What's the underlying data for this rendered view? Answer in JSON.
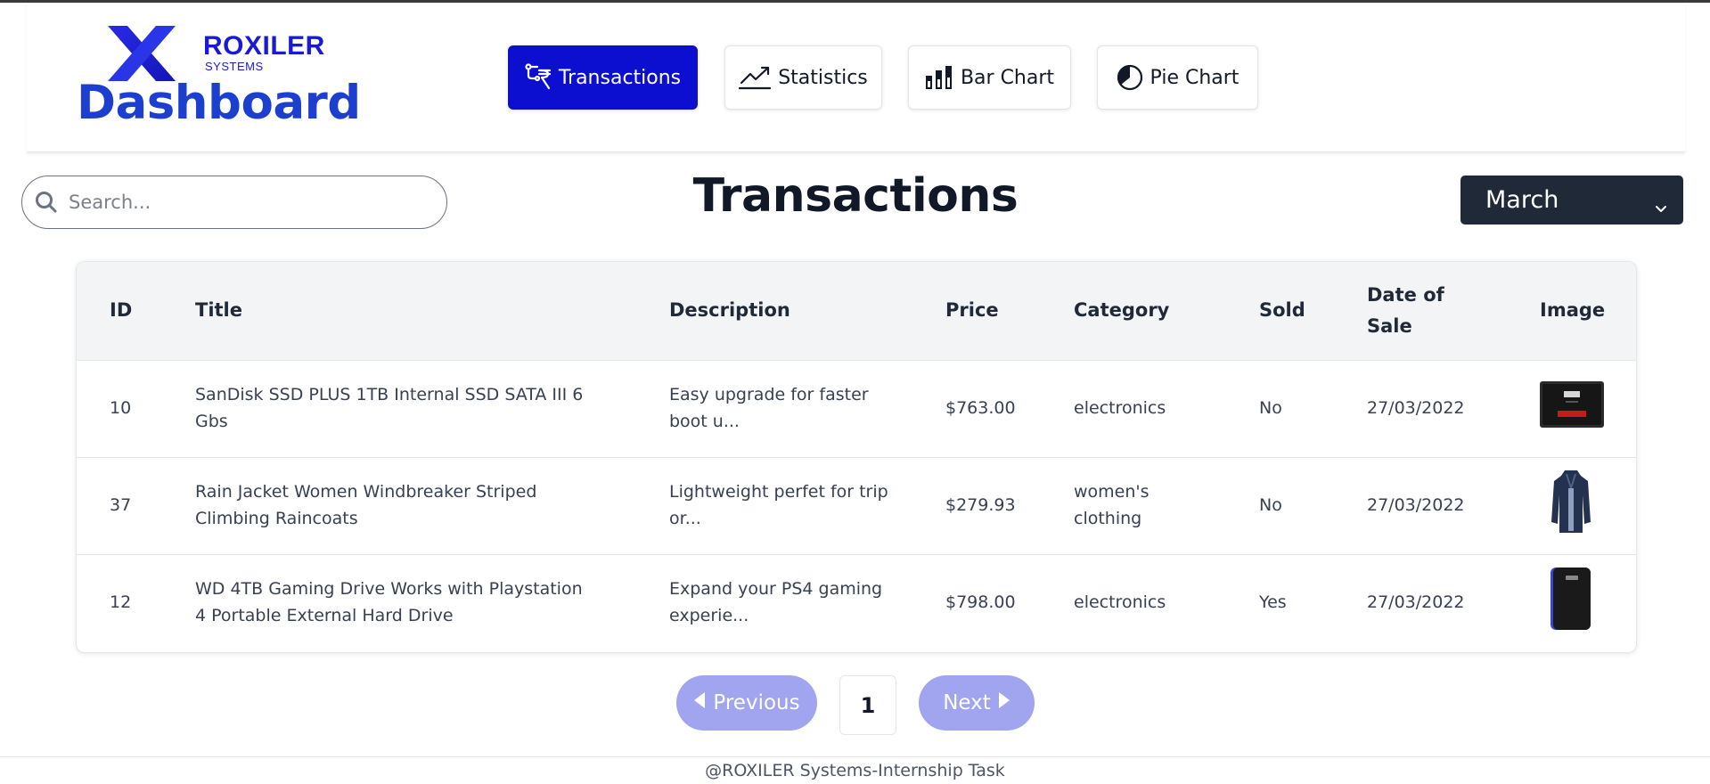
{
  "brand": {
    "name": "ROXILER",
    "sub": "SYSTEMS",
    "title": "Dashboard",
    "colors": {
      "primary": "#0d0fd0",
      "logo": "#1a1ad6"
    }
  },
  "nav": [
    {
      "label": "Transactions",
      "icon": "transactions-icon",
      "active": true
    },
    {
      "label": "Statistics",
      "icon": "trend-icon",
      "active": false
    },
    {
      "label": "Bar Chart",
      "icon": "bar-chart-icon",
      "active": false
    },
    {
      "label": "Pie Chart",
      "icon": "pie-chart-icon",
      "active": false
    }
  ],
  "search": {
    "placeholder": "Search...",
    "value": ""
  },
  "page_title": "Transactions",
  "month_select": {
    "value": "March"
  },
  "table": {
    "headers": {
      "id": "ID",
      "title": "Title",
      "description": "Description",
      "price": "Price",
      "category": "Category",
      "sold": "Sold",
      "date": "Date of Sale",
      "image": "Image"
    },
    "rows": [
      {
        "id": "10",
        "title": "SanDisk SSD PLUS 1TB Internal SSD SATA III 6 Gbs",
        "description": "Easy upgrade for faster boot u...",
        "price": "$763.00",
        "category": "electronics",
        "sold": "No",
        "date": "27/03/2022",
        "image": "sandisk-ssd-thumbnail"
      },
      {
        "id": "37",
        "title": "Rain Jacket Women Windbreaker Striped Climbing Raincoats",
        "description": "Lightweight perfet for trip or...",
        "price": "$279.93",
        "category": "women's clothing",
        "sold": "No",
        "date": "27/03/2022",
        "image": "rain-jacket-thumbnail"
      },
      {
        "id": "12",
        "title": "WD 4TB Gaming Drive Works with Playstation 4 Portable External Hard Drive",
        "description": "Expand your PS4 gaming experie...",
        "price": "$798.00",
        "category": "electronics",
        "sold": "Yes",
        "date": "27/03/2022",
        "image": "hard-drive-thumbnail"
      }
    ]
  },
  "pagination": {
    "previous": "Previous",
    "next": "Next",
    "page": "1"
  },
  "footer": "@ROXILER Systems-Internship Task"
}
